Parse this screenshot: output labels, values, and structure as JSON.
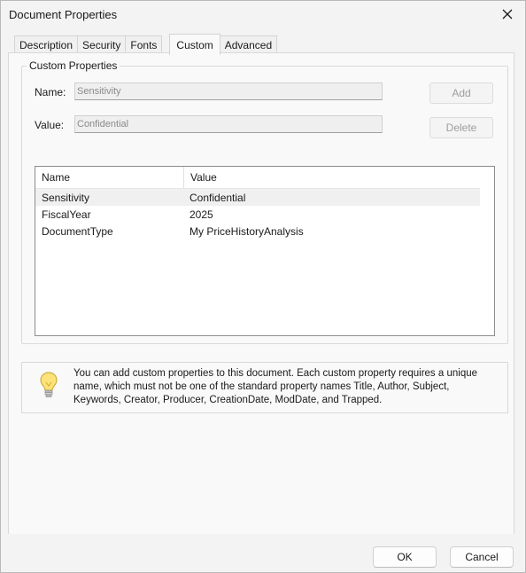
{
  "window": {
    "title": "Document Properties",
    "close_icon": "close-icon"
  },
  "tabs": [
    {
      "label": "Description",
      "active": false
    },
    {
      "label": "Security",
      "active": false
    },
    {
      "label": "Fonts",
      "active": false
    },
    {
      "label": "Custom",
      "active": true
    },
    {
      "label": "Advanced",
      "active": false
    }
  ],
  "custom": {
    "legend": "Custom Properties",
    "name_label": "Name:",
    "name_value": "Sensitivity",
    "value_label": "Value:",
    "value_value": "Confidential",
    "add_label": "Add",
    "delete_label": "Delete",
    "list": {
      "columns": [
        "Name",
        "Value"
      ],
      "rows": [
        {
          "name": "Sensitivity",
          "value": "Confidential",
          "selected": true
        },
        {
          "name": "FiscalYear",
          "value": "2025",
          "selected": false
        },
        {
          "name": "DocumentType",
          "value": "My PriceHistoryAnalysis",
          "selected": false
        }
      ]
    }
  },
  "info": {
    "icon": "lightbulb-icon",
    "text": "You can add custom properties to this document. Each custom property requires a unique name, which must not be one of the standard property names Title, Author, Subject, Keywords, Creator, Producer, CreationDate, ModDate, and Trapped."
  },
  "footer": {
    "ok_label": "OK",
    "cancel_label": "Cancel"
  }
}
